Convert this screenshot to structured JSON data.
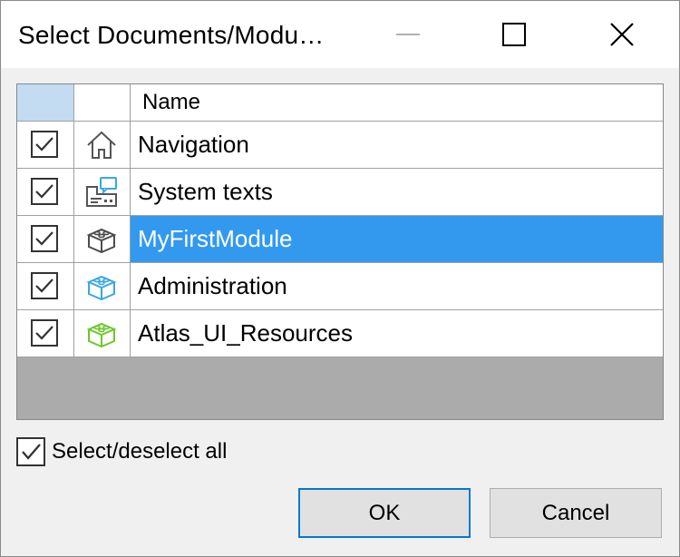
{
  "window": {
    "title": "Select Documents/Modu…",
    "controls": [
      "minimize-icon",
      "maximize-icon",
      "close-icon"
    ]
  },
  "grid": {
    "header": {
      "name": "Name"
    },
    "rows": [
      {
        "name": "Navigation",
        "checked": true,
        "icon": "home-icon",
        "selected": false
      },
      {
        "name": "System texts",
        "checked": true,
        "icon": "system-texts-icon",
        "selected": false
      },
      {
        "name": "MyFirstModule",
        "checked": true,
        "icon": "module-icon",
        "selected": true
      },
      {
        "name": "Administration",
        "checked": true,
        "icon": "module-icon",
        "selected": false
      },
      {
        "name": "Atlas_UI_Resources",
        "checked": true,
        "icon": "module-icon",
        "selected": false
      }
    ]
  },
  "select_all": {
    "label": "Select/deselect all",
    "checked": true
  },
  "buttons": {
    "ok": "OK",
    "cancel": "Cancel"
  },
  "colors": {
    "selection": "#3399ee",
    "header_check_cell": "#c3dcf1",
    "module_dark": "#4d4d4d",
    "module_blue": "#3aa6e8",
    "module_green": "#6cc72a",
    "ok_border": "#0078d7"
  }
}
